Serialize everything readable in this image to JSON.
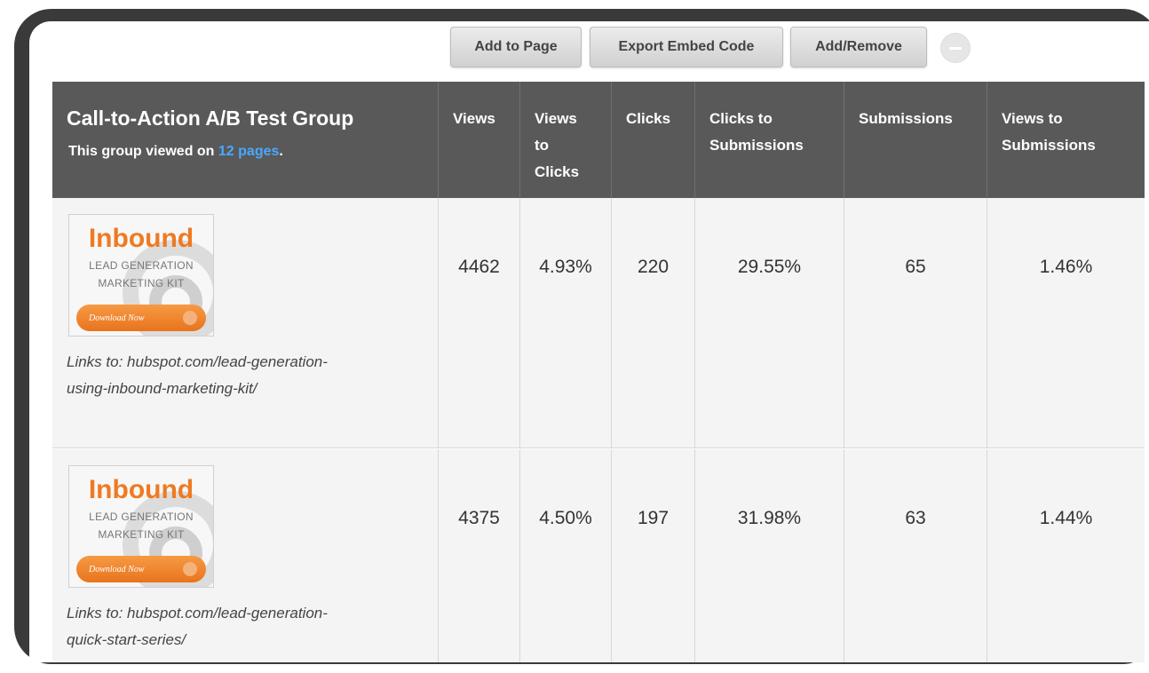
{
  "toolbar": {
    "add_to_page": "Add to Page",
    "export_embed_code": "Export Embed Code",
    "add_remove": "Add/Remove",
    "remove_icon": "minus-icon"
  },
  "table": {
    "group_title": "Call-to-Action A/B Test Group",
    "group_sub_prefix": "This group viewed on ",
    "group_sub_link": "12 pages",
    "group_sub_suffix": ".",
    "columns": {
      "views": "Views",
      "views_to_clicks_1": "Views",
      "views_to_clicks_2": "to",
      "views_to_clicks_3": "Clicks",
      "clicks": "Clicks",
      "clicks_to_submissions_1": "Clicks to",
      "clicks_to_submissions_2": "Submissions",
      "submissions": "Submissions",
      "views_to_submissions_1": "Views to",
      "views_to_submissions_2": "Submissions"
    },
    "rows": [
      {
        "thumb_title": "Inbound",
        "thumb_line1": "LEAD GENERATION",
        "thumb_line2": "MARKETING KIT",
        "thumb_button": "Download Now",
        "link_line1": "Links to: hubspot.com/lead-generation-",
        "link_line2": "using-inbound-marketing-kit/",
        "views": "4462",
        "views_to_clicks": "4.93%",
        "clicks": "220",
        "clicks_to_submissions": "29.55%",
        "submissions": "65",
        "views_to_submissions": "1.46%"
      },
      {
        "thumb_title": "Inbound",
        "thumb_line1": "LEAD GENERATION",
        "thumb_line2": "MARKETING KIT",
        "thumb_button": "Download Now",
        "link_line1": "Links to: hubspot.com/lead-generation-",
        "link_line2": "quick-start-series/",
        "views": "4375",
        "views_to_clicks": "4.50%",
        "clicks": "197",
        "clicks_to_submissions": "31.98%",
        "submissions": "63",
        "views_to_submissions": "1.44%"
      }
    ]
  },
  "colors": {
    "header_bg": "#595959",
    "link_blue": "#4aa8ff",
    "brand_orange": "#ef7a22",
    "row_bg": "#f4f4f4"
  }
}
